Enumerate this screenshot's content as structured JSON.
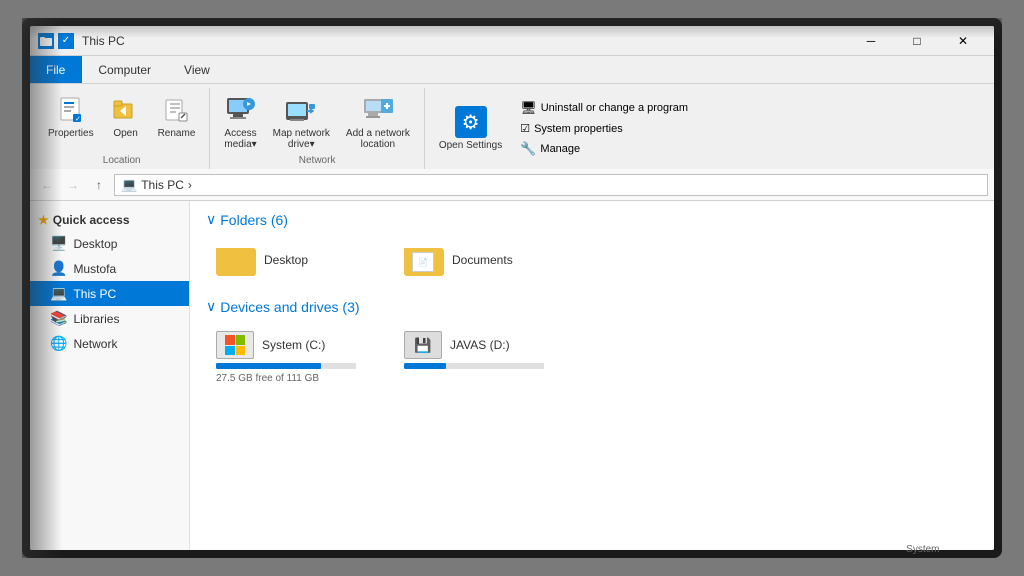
{
  "window": {
    "title": "This PC",
    "title_bar": {
      "pin_icon": "📌",
      "title_text": "This PC"
    }
  },
  "ribbon": {
    "tabs": [
      {
        "id": "file",
        "label": "File"
      },
      {
        "id": "computer",
        "label": "Computer"
      },
      {
        "id": "view",
        "label": "View"
      }
    ],
    "active_tab": "computer",
    "groups": {
      "location": {
        "label": "Location",
        "buttons": [
          {
            "id": "properties",
            "label": "Properties",
            "icon": "📋"
          },
          {
            "id": "open",
            "label": "Open",
            "icon": "📂"
          },
          {
            "id": "rename",
            "label": "Rename",
            "icon": "✏️"
          }
        ]
      },
      "network": {
        "label": "Network",
        "buttons": [
          {
            "id": "access-media",
            "label": "Access media▾",
            "icon": "🖥️"
          },
          {
            "id": "map-network-drive",
            "label": "Map network drive▾",
            "icon": "🗄️"
          },
          {
            "id": "add-network-location",
            "label": "Add a network location",
            "icon": "🖥️"
          }
        ]
      },
      "system": {
        "label": "System",
        "open_settings": "Open Settings",
        "buttons": [
          {
            "id": "uninstall",
            "label": "Uninstall or change a program"
          },
          {
            "id": "system-properties",
            "label": "System properties"
          },
          {
            "id": "manage",
            "label": "Manage"
          }
        ]
      }
    }
  },
  "address_bar": {
    "path": "This PC",
    "path_parts": [
      "This PC"
    ]
  },
  "sidebar": {
    "quick_access_label": "Quick access",
    "items": [
      {
        "id": "desktop",
        "label": "Desktop",
        "icon": "🖥️"
      },
      {
        "id": "mustofa",
        "label": "Mustofa",
        "icon": "👤"
      },
      {
        "id": "this-pc",
        "label": "This PC",
        "icon": "💻",
        "active": true
      },
      {
        "id": "libraries",
        "label": "Libraries",
        "icon": "📚"
      },
      {
        "id": "network",
        "label": "Network",
        "icon": "🌐"
      }
    ]
  },
  "content": {
    "folders_section": {
      "label": "Folders (6)",
      "items": [
        {
          "id": "desktop",
          "label": "Desktop"
        },
        {
          "id": "documents",
          "label": "Documents"
        }
      ]
    },
    "drives_section": {
      "label": "Devices and drives (3)",
      "items": [
        {
          "id": "system-c",
          "label": "System (C:)",
          "free": "27.5 GB free of 111 GB",
          "progress_pct": 75
        },
        {
          "id": "javas-d",
          "label": "JAVAS (D:)",
          "free": "",
          "progress_pct": 30
        }
      ]
    }
  },
  "icons": {
    "back": "←",
    "forward": "→",
    "up": "↑",
    "chevron_right": "›",
    "chevron_down": "∨",
    "star": "★",
    "folder": "📁",
    "gear": "⚙",
    "monitor": "🖥",
    "network_monitor": "🖥",
    "checkbox": "☑",
    "settings": "⚙"
  }
}
